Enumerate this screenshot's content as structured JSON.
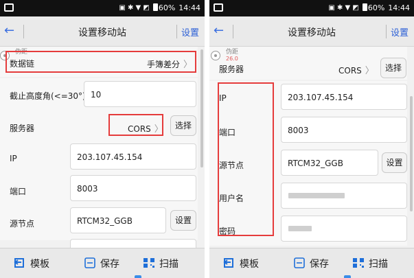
{
  "status_bar": {
    "battery": "60%",
    "time": "14:44"
  },
  "header": {
    "title": "设置移动站",
    "settings_label": "设置"
  },
  "floating_badge": {
    "line1": "伪距",
    "line2": "26.0"
  },
  "form": {
    "data_link_label": "数据链",
    "data_link_value": "手簿差分",
    "cutoff_label": "截止高度角(<=30°)",
    "cutoff_value": "10",
    "server_label": "服务器",
    "server_value": "CORS",
    "choose_label": "选择",
    "ip_label": "IP",
    "ip_value": "203.107.45.154",
    "port_label": "端口",
    "port_value": "8003",
    "mountpoint_label": "源节点",
    "mountpoint_value": "RTCM32_GGB",
    "mountpoint_button": "设置",
    "username_label": "用户名",
    "password_label": "密码"
  },
  "toolbar": {
    "template_label": "模板",
    "save_label": "保存",
    "scan_label": "扫描"
  },
  "colors": {
    "accent": "#2b5fd6",
    "highlight": "#e53b3b",
    "status_bar": "#111111"
  }
}
